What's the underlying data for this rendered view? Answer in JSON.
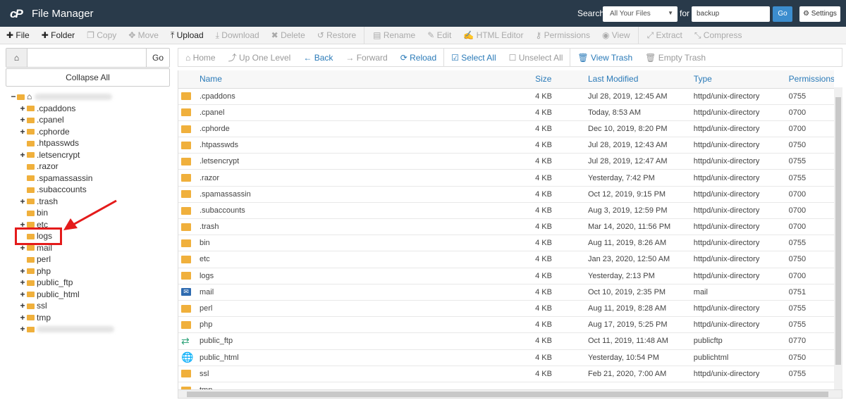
{
  "header": {
    "logo": "cP",
    "title": "File Manager",
    "search_label": "Search",
    "search_scope": "All Your Files",
    "for_label": "for",
    "search_query": "backup",
    "go": "Go",
    "settings": "Settings"
  },
  "toolbar": [
    {
      "icon": "plus-icon",
      "label": "File",
      "enabled": true
    },
    {
      "icon": "plus-icon",
      "label": "Folder",
      "enabled": true
    },
    {
      "icon": "copy-icon",
      "label": "Copy",
      "enabled": false
    },
    {
      "icon": "move-icon",
      "label": "Move",
      "enabled": false
    },
    {
      "icon": "upload-icon",
      "label": "Upload",
      "enabled": true
    },
    {
      "icon": "download-icon",
      "label": "Download",
      "enabled": false
    },
    {
      "icon": "delete-icon",
      "label": "Delete",
      "enabled": false
    },
    {
      "icon": "restore-icon",
      "label": "Restore",
      "enabled": false
    },
    {
      "icon": "rename-icon",
      "label": "Rename",
      "enabled": false
    },
    {
      "icon": "edit-icon",
      "label": "Edit",
      "enabled": false
    },
    {
      "icon": "html-editor-icon",
      "label": "HTML Editor",
      "enabled": false
    },
    {
      "icon": "key-icon",
      "label": "Permissions",
      "enabled": false
    },
    {
      "icon": "eye-icon",
      "label": "View",
      "enabled": false
    },
    {
      "icon": "extract-icon",
      "label": "Extract",
      "enabled": false
    },
    {
      "icon": "compress-icon",
      "label": "Compress",
      "enabled": false
    }
  ],
  "sidebar": {
    "path_value": "",
    "go": "Go",
    "collapse": "Collapse All",
    "tree": [
      {
        "label": ".cpaddons",
        "expand": true
      },
      {
        "label": ".cpanel",
        "expand": true
      },
      {
        "label": ".cphorde",
        "expand": true
      },
      {
        "label": ".htpasswds",
        "expand": false
      },
      {
        "label": ".letsencrypt",
        "expand": true
      },
      {
        "label": ".razor",
        "expand": false
      },
      {
        "label": ".spamassassin",
        "expand": false
      },
      {
        "label": ".subaccounts",
        "expand": false
      },
      {
        "label": ".trash",
        "expand": true
      },
      {
        "label": "bin",
        "expand": false
      },
      {
        "label": "etc",
        "expand": true
      },
      {
        "label": "logs",
        "expand": false
      },
      {
        "label": "mail",
        "expand": true
      },
      {
        "label": "perl",
        "expand": false
      },
      {
        "label": "php",
        "expand": true
      },
      {
        "label": "public_ftp",
        "expand": true
      },
      {
        "label": "public_html",
        "expand": true
      },
      {
        "label": "ssl",
        "expand": true
      },
      {
        "label": "tmp",
        "expand": true
      }
    ]
  },
  "nav": [
    {
      "icon": "home-icon",
      "label": "Home",
      "active": false
    },
    {
      "icon": "up-level-icon",
      "label": "Up One Level",
      "active": false
    },
    {
      "icon": "arrow-left-icon",
      "label": "Back",
      "active": true
    },
    {
      "icon": "arrow-right-icon",
      "label": "Forward",
      "active": false
    },
    {
      "icon": "reload-icon",
      "label": "Reload",
      "active": true
    },
    {
      "icon": "checkbox-checked-icon",
      "label": "Select All",
      "active": true
    },
    {
      "icon": "checkbox-icon",
      "label": "Unselect All",
      "active": false
    },
    {
      "icon": "trash-icon",
      "label": "View Trash",
      "active": true
    },
    {
      "icon": "trash-icon",
      "label": "Empty Trash",
      "active": false
    }
  ],
  "table": {
    "columns": [
      "Name",
      "Size",
      "Last Modified",
      "Type",
      "Permissions"
    ],
    "rows": [
      {
        "icon": "folder",
        "name": ".cpaddons",
        "size": "4 KB",
        "modified": "Jul 28, 2019, 12:45 AM",
        "type": "httpd/unix-directory",
        "perm": "0755"
      },
      {
        "icon": "folder",
        "name": ".cpanel",
        "size": "4 KB",
        "modified": "Today, 8:53 AM",
        "type": "httpd/unix-directory",
        "perm": "0700"
      },
      {
        "icon": "folder",
        "name": ".cphorde",
        "size": "4 KB",
        "modified": "Dec 10, 2019, 8:20 PM",
        "type": "httpd/unix-directory",
        "perm": "0700"
      },
      {
        "icon": "folder",
        "name": ".htpasswds",
        "size": "4 KB",
        "modified": "Jul 28, 2019, 12:43 AM",
        "type": "httpd/unix-directory",
        "perm": "0750"
      },
      {
        "icon": "folder",
        "name": ".letsencrypt",
        "size": "4 KB",
        "modified": "Jul 28, 2019, 12:47 AM",
        "type": "httpd/unix-directory",
        "perm": "0755"
      },
      {
        "icon": "folder",
        "name": ".razor",
        "size": "4 KB",
        "modified": "Yesterday, 7:42 PM",
        "type": "httpd/unix-directory",
        "perm": "0755"
      },
      {
        "icon": "folder",
        "name": ".spamassassin",
        "size": "4 KB",
        "modified": "Oct 12, 2019, 9:15 PM",
        "type": "httpd/unix-directory",
        "perm": "0700"
      },
      {
        "icon": "folder",
        "name": ".subaccounts",
        "size": "4 KB",
        "modified": "Aug 3, 2019, 12:59 PM",
        "type": "httpd/unix-directory",
        "perm": "0700"
      },
      {
        "icon": "folder",
        "name": ".trash",
        "size": "4 KB",
        "modified": "Mar 14, 2020, 11:56 PM",
        "type": "httpd/unix-directory",
        "perm": "0700"
      },
      {
        "icon": "folder",
        "name": "bin",
        "size": "4 KB",
        "modified": "Aug 11, 2019, 8:26 AM",
        "type": "httpd/unix-directory",
        "perm": "0755"
      },
      {
        "icon": "folder",
        "name": "etc",
        "size": "4 KB",
        "modified": "Jan 23, 2020, 12:50 AM",
        "type": "httpd/unix-directory",
        "perm": "0750"
      },
      {
        "icon": "folder",
        "name": "logs",
        "size": "4 KB",
        "modified": "Yesterday, 2:13 PM",
        "type": "httpd/unix-directory",
        "perm": "0700"
      },
      {
        "icon": "mail",
        "name": "mail",
        "size": "4 KB",
        "modified": "Oct 10, 2019, 2:35 PM",
        "type": "mail",
        "perm": "0751"
      },
      {
        "icon": "folder",
        "name": "perl",
        "size": "4 KB",
        "modified": "Aug 11, 2019, 8:28 AM",
        "type": "httpd/unix-directory",
        "perm": "0755"
      },
      {
        "icon": "folder",
        "name": "php",
        "size": "4 KB",
        "modified": "Aug 17, 2019, 5:25 PM",
        "type": "httpd/unix-directory",
        "perm": "0755"
      },
      {
        "icon": "ftp",
        "name": "public_ftp",
        "size": "4 KB",
        "modified": "Oct 11, 2019, 11:48 AM",
        "type": "publicftp",
        "perm": "0770"
      },
      {
        "icon": "globe",
        "name": "public_html",
        "size": "4 KB",
        "modified": "Yesterday, 10:54 PM",
        "type": "publichtml",
        "perm": "0750"
      },
      {
        "icon": "folder",
        "name": "ssl",
        "size": "4 KB",
        "modified": "Feb 21, 2020, 7:00 AM",
        "type": "httpd/unix-directory",
        "perm": "0755"
      },
      {
        "icon": "folder",
        "name": "tmp",
        "size": "",
        "modified": "",
        "type": "",
        "perm": ""
      }
    ]
  },
  "colors": {
    "header_bg": "#293a4a",
    "link": "#2a7ab8",
    "folder": "#f0b03c",
    "highlight": "#e41b1b",
    "go_button": "#3c8dce"
  }
}
